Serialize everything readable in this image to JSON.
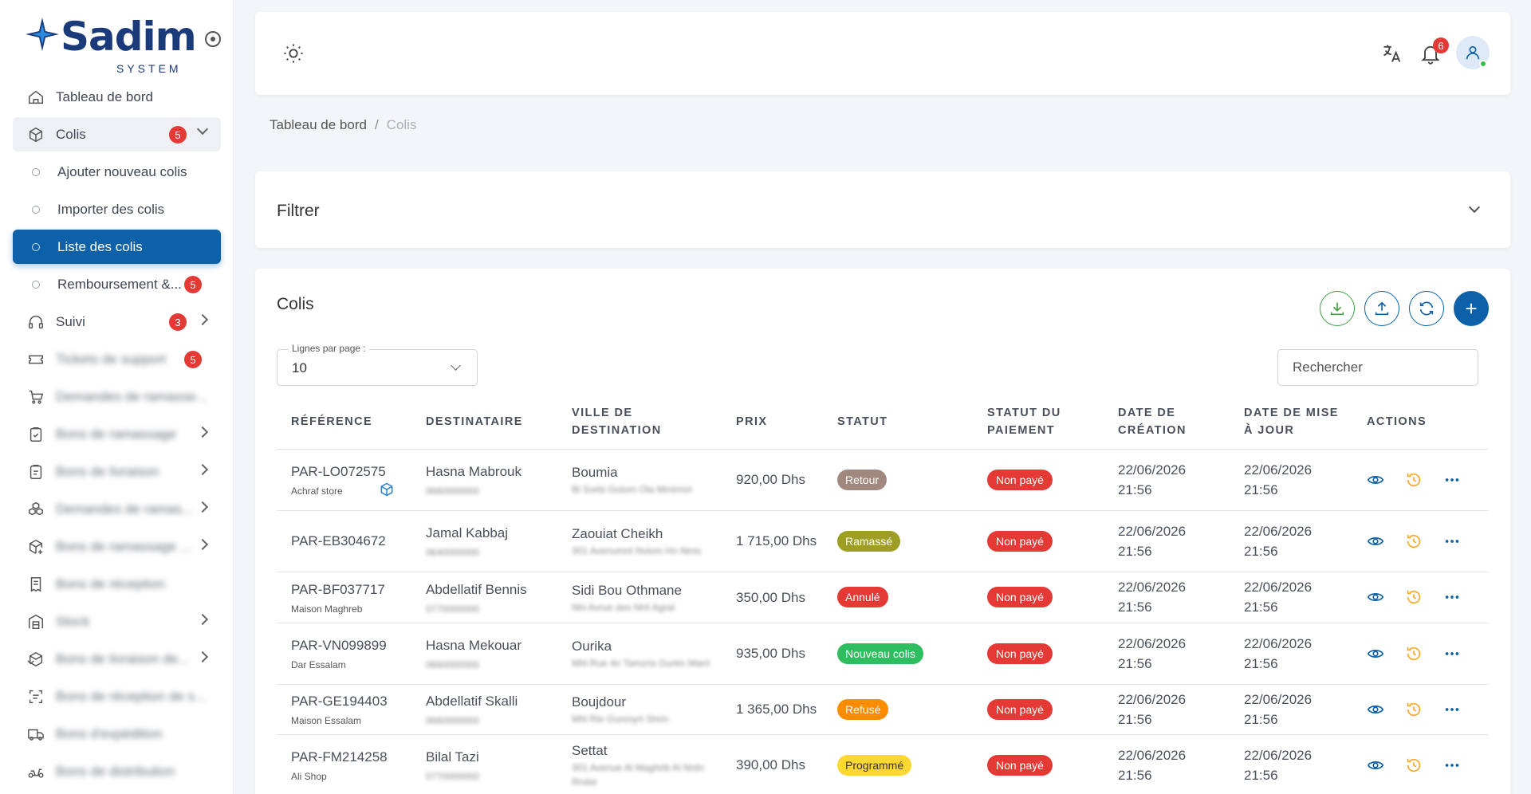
{
  "brand": {
    "name": "Sadim",
    "tagline": "SYSTEM"
  },
  "sidebar": {
    "items": [
      {
        "label": "Tableau de bord",
        "icon": "home-icon"
      },
      {
        "label": "Colis",
        "icon": "package-icon",
        "badge": "5"
      },
      {
        "label": "Ajouter nouveau colis",
        "sub": true
      },
      {
        "label": "Importer des colis",
        "sub": true
      },
      {
        "label": "Liste des colis",
        "sub": true,
        "active": true
      },
      {
        "label": "Remboursement &...",
        "sub": true,
        "badge": "5"
      },
      {
        "label": "Suivi",
        "icon": "headset-icon",
        "badge": "3"
      },
      {
        "label": "Tickets de support",
        "icon": "ticket-icon",
        "badge": "5"
      },
      {
        "label": "Demandes de ramasse...",
        "icon": "cart-icon"
      },
      {
        "label": "Bons de ramassage",
        "icon": "clipboard-check-icon"
      },
      {
        "label": "Bons de livraison",
        "icon": "clipboard-icon"
      },
      {
        "label": "Demandes de ramas...",
        "icon": "boxes-icon"
      },
      {
        "label": "Bons de ramassage ...",
        "icon": "package-plus-icon"
      },
      {
        "label": "Bons de réception",
        "icon": "receipt-icon"
      },
      {
        "label": "Stock",
        "icon": "warehouse-icon"
      },
      {
        "label": "Bons de livraison de...",
        "icon": "package-return-icon"
      },
      {
        "label": "Bons de réception de s...",
        "icon": "scan-icon"
      },
      {
        "label": "Bons d'expédition",
        "icon": "truck-icon"
      },
      {
        "label": "Bons de distribution",
        "icon": "scooter-icon"
      }
    ]
  },
  "topbar": {
    "notifications": "6"
  },
  "breadcrumb": {
    "home": "Tableau de bord",
    "separator": "/",
    "current": "Colis"
  },
  "filter": {
    "title": "Filtrer"
  },
  "card": {
    "title": "Colis",
    "rows_label": "Lignes par page :",
    "rows_value": "10",
    "search_placeholder": "Rechercher"
  },
  "table": {
    "headers": [
      "RÉFÉRENCE",
      "DESTINATAIRE",
      "VILLE DE DESTINATION",
      "PRIX",
      "STATUT",
      "STATUT DU PAIEMENT",
      "DATE DE CRÉATION",
      "DATE DE MISE À JOUR",
      "ACTIONS"
    ],
    "rows": [
      {
        "ref": "PAR-LO072575",
        "store": "Achraf store",
        "name": "Hasna Mabrouk",
        "phone": "0660000000",
        "city": "Boumia",
        "addr": "Bl Sorbi Gutom Ola Mmirmrt",
        "price": "920,00 Dhs",
        "status": "Retour",
        "status_color": "#a1887f",
        "payment": "Non payé",
        "created": "22/06/2026 21:56",
        "updated": "22/06/2026 21:56"
      },
      {
        "ref": "PAR-EB304672",
        "store": "",
        "name": "Jamal Kabbaj",
        "phone": "0640000000",
        "city": "Zaouiat Cheikh",
        "addr": "301 Avenumnt Nviom Hn Ninis",
        "price": "1 715,00 Dhs",
        "status": "Ramassé",
        "status_color": "#9e9d24",
        "payment": "Non payé",
        "created": "22/06/2026 21:56",
        "updated": "22/06/2026 21:56"
      },
      {
        "ref": "PAR-BF037717",
        "store": "Maison Maghreb",
        "name": "Abdellatif Bennis",
        "phone": "0770000000",
        "city": "Sidi Bou Othmane",
        "addr": "Nhi Avrue des NHi Agrat",
        "price": "350,00 Dhs",
        "status": "Annulé",
        "status_color": "#e53935",
        "payment": "Non payé",
        "created": "22/06/2026 21:56",
        "updated": "22/06/2026 21:56"
      },
      {
        "ref": "PAR-VN099899",
        "store": "Dar Essalam",
        "name": "Hasna Mekouar",
        "phone": "0660000000",
        "city": "Ourika",
        "addr": "Mhl Rue 4n Tamzris Gurtm Marrl",
        "price": "935,00 Dhs",
        "status": "Nouveau colis",
        "status_color": "#2ebd5f",
        "payment": "Non payé",
        "created": "22/06/2026 21:56",
        "updated": "22/06/2026 21:56"
      },
      {
        "ref": "PAR-GE194403",
        "store": "Maison Essalam",
        "name": "Abdellatif Skalli",
        "phone": "0660000000",
        "city": "Boujdour",
        "addr": "Mhl Rie Gunmyrt Shrin",
        "price": "1 365,00 Dhs",
        "status": "Refusé",
        "status_color": "#fb8c00",
        "payment": "Non payé",
        "created": "22/06/2026 21:56",
        "updated": "22/06/2026 21:56"
      },
      {
        "ref": "PAR-FM214258",
        "store": "Ali Shop",
        "name": "Bilal Tazi",
        "phone": "0770000000",
        "city": "Settat",
        "addr": "301 Avenue Al Maghrib Al Nrdn Rrvbir",
        "price": "390,00 Dhs",
        "status": "Programmé",
        "status_color": "#fdd835",
        "status_text_color": "#333333",
        "payment": "Non payé",
        "created": "22/06/2026 21:56",
        "updated": "22/06/2026 21:56"
      }
    ]
  },
  "colors": {
    "primary": "#0d61a8",
    "danger": "#e53935",
    "success": "#43a047",
    "warning": "#f9a825"
  }
}
